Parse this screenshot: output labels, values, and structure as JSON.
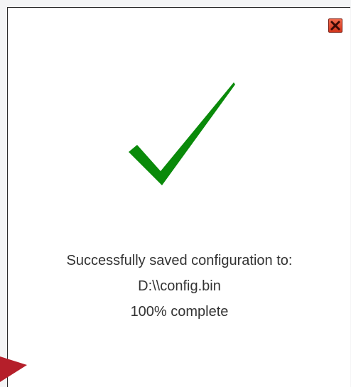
{
  "dialog": {
    "close_icon": "close-x-icon",
    "status_icon": "checkmark-icon",
    "message_line1": "Successfully saved configuration to:",
    "file_path": "D:\\\\config.bin",
    "progress_text": "100% complete",
    "progress_percent": 100
  },
  "colors": {
    "check_green": "#0a8a0a",
    "close_red": "#d8351c",
    "pointer_red": "#b51f2a",
    "text": "#333333"
  }
}
